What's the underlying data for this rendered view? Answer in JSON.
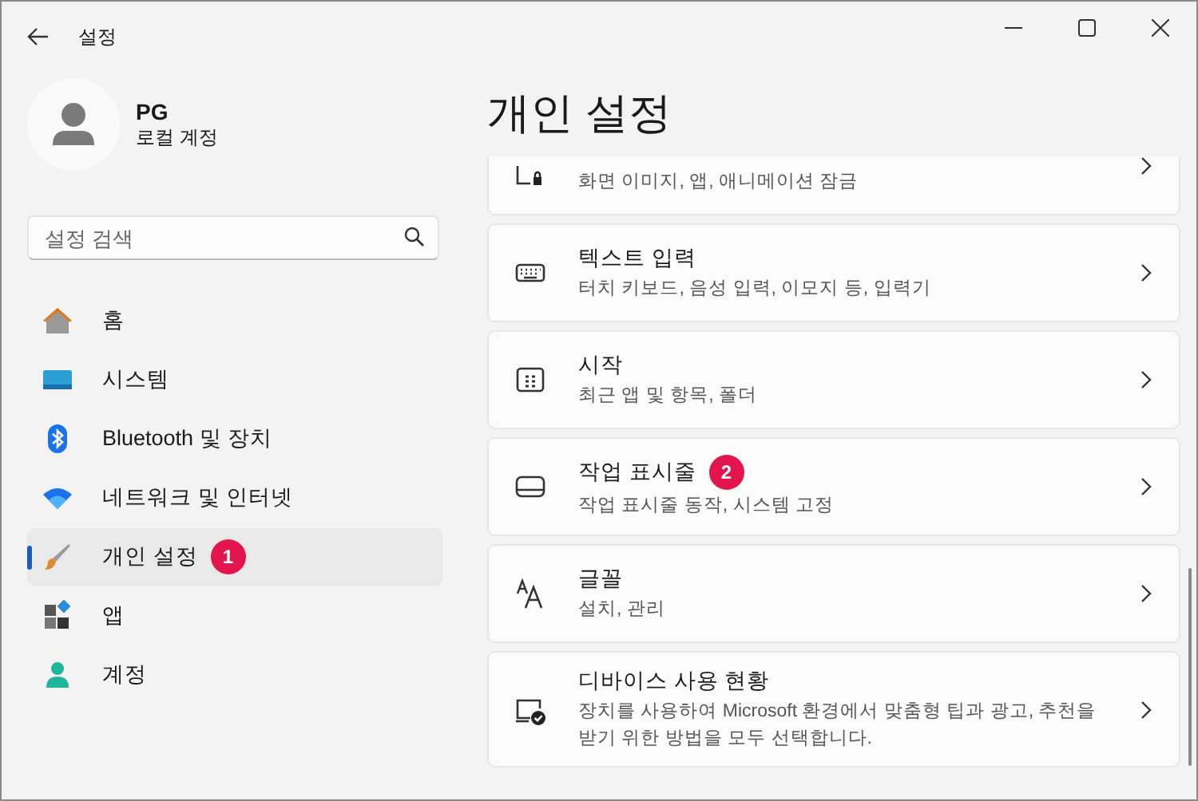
{
  "window": {
    "title": "설정"
  },
  "account": {
    "name": "PG",
    "type": "로컬 계정"
  },
  "search": {
    "placeholder": "설정 검색"
  },
  "nav": [
    {
      "kind": "home",
      "label": "홈",
      "selected": false
    },
    {
      "kind": "system",
      "label": "시스템",
      "selected": false
    },
    {
      "kind": "bluetooth",
      "label": "Bluetooth 및 장치",
      "selected": false
    },
    {
      "kind": "network",
      "label": "네트워크 및 인터넷",
      "selected": false
    },
    {
      "kind": "brush",
      "label": "개인 설정",
      "selected": true,
      "badge": "1"
    },
    {
      "kind": "apps",
      "label": "앱",
      "selected": false
    },
    {
      "kind": "account",
      "label": "계정",
      "selected": false
    }
  ],
  "page_title": "개인 설정",
  "cards": [
    {
      "kind": "lock",
      "description": "화면 이미지, 앱, 애니메이션 잠금"
    },
    {
      "kind": "keyboard",
      "title": "텍스트 입력",
      "description": "터치 키보드, 음성 입력, 이모지 등, 입력기"
    },
    {
      "kind": "start",
      "title": "시작",
      "description": "최근 앱 및 항목, 폴더"
    },
    {
      "kind": "taskbar",
      "title": "작업 표시줄",
      "description": "작업 표시줄 동작, 시스템 고정",
      "badge": "2"
    },
    {
      "kind": "fonts",
      "title": "글꼴",
      "description": "설치, 관리"
    },
    {
      "kind": "device",
      "title": "디바이스 사용 현황",
      "description": "장치를 사용하여 Microsoft 환경에서 맞춤형 팁과 광고, 추천을 받기 위한 방법을 모두 선택합니다."
    }
  ]
}
